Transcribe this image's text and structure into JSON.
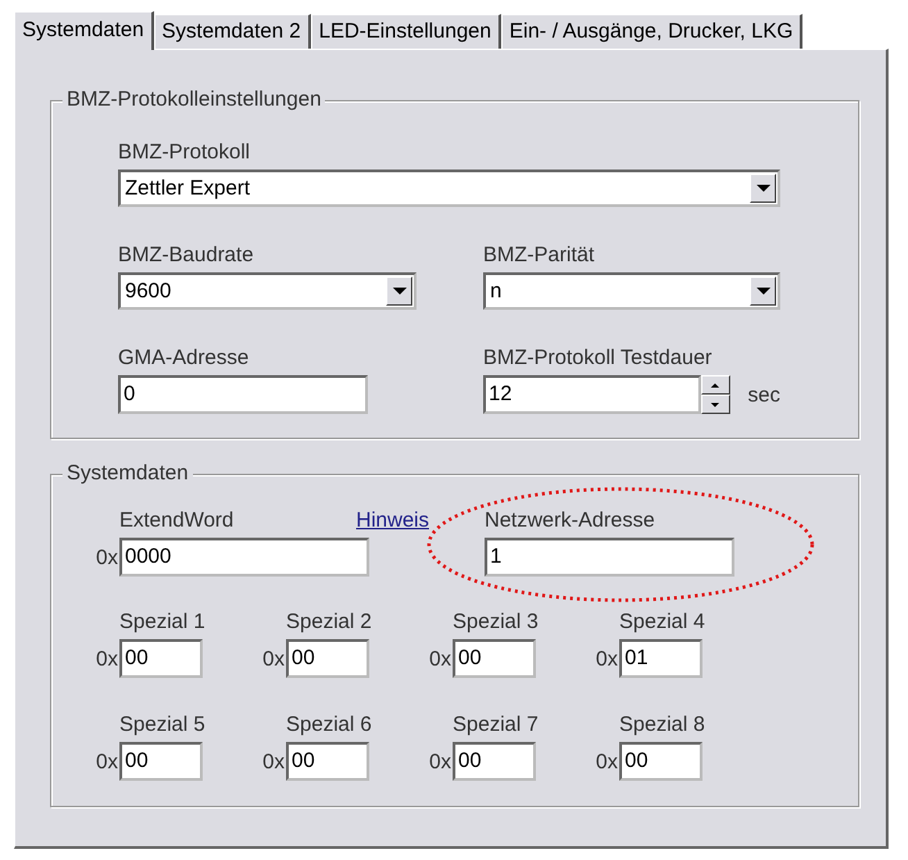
{
  "tabs": [
    {
      "label": "Systemdaten",
      "selected": true
    },
    {
      "label": "Systemdaten 2",
      "selected": false
    },
    {
      "label": "LED-Einstellungen",
      "selected": false
    },
    {
      "label": "Ein- / Ausgänge, Drucker, LKG",
      "selected": false
    }
  ],
  "protocol_settings": {
    "title": "BMZ-Protokolleinstellungen",
    "protocol": {
      "label": "BMZ-Protokoll",
      "value": "Zettler Expert"
    },
    "baudrate": {
      "label": "BMZ-Baudrate",
      "value": "9600"
    },
    "parity": {
      "label": "BMZ-Parität",
      "value": "n"
    },
    "gma_address": {
      "label": "GMA-Adresse",
      "value": "0"
    },
    "test_duration": {
      "label": "BMZ-Protokoll Testdauer",
      "value": "12",
      "unit": "sec"
    }
  },
  "system_data": {
    "title": "Systemdaten",
    "extend_word": {
      "label": "ExtendWord",
      "prefix": "0x",
      "value": "0000"
    },
    "hint_link": "Hinweis",
    "network_address": {
      "label": "Netzwerk-Adresse",
      "value": "1"
    },
    "special": [
      {
        "label": "Spezial 1",
        "prefix": "0x",
        "value": "00"
      },
      {
        "label": "Spezial 2",
        "prefix": "0x",
        "value": "00"
      },
      {
        "label": "Spezial 3",
        "prefix": "0x",
        "value": "00"
      },
      {
        "label": "Spezial 4",
        "prefix": "0x",
        "value": "01"
      },
      {
        "label": "Spezial 5",
        "prefix": "0x",
        "value": "00"
      },
      {
        "label": "Spezial 6",
        "prefix": "0x",
        "value": "00"
      },
      {
        "label": "Spezial 7",
        "prefix": "0x",
        "value": "00"
      },
      {
        "label": "Spezial 8",
        "prefix": "0x",
        "value": "00"
      }
    ]
  }
}
